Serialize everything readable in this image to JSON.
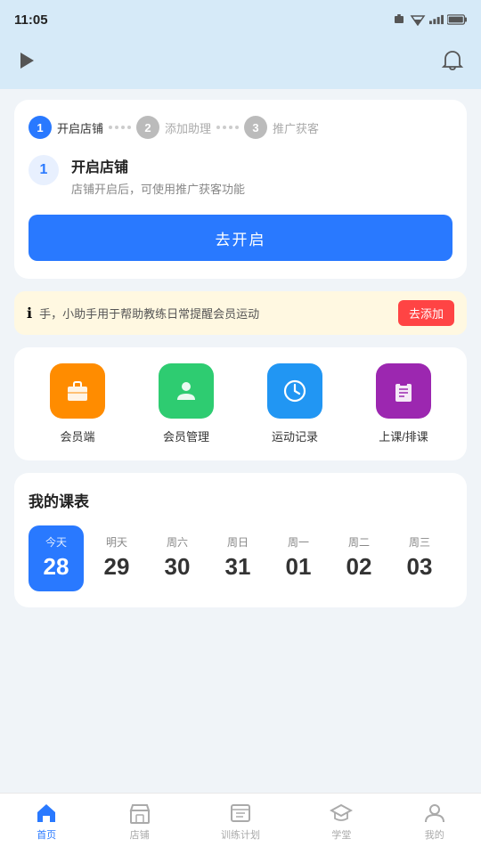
{
  "statusBar": {
    "time": "11:05",
    "icons": "▲ ▲ 🔋"
  },
  "header": {
    "playLabel": "play",
    "bellLabel": "notification"
  },
  "steps": {
    "step1": {
      "num": "1",
      "label": "开启店铺",
      "active": true
    },
    "step2": {
      "num": "2",
      "label": "添加助理",
      "active": false
    },
    "step3": {
      "num": "3",
      "label": "推广获客",
      "active": false
    },
    "detailNum": "1",
    "detailTitle": "开启店铺",
    "detailDesc": "店铺开启后，可使用推广获客功能",
    "btnLabel": "去开启"
  },
  "notice": {
    "icon": "ℹ",
    "text": "手，小助手用于帮助教练日常提醒会员运动",
    "btnLabel": "去添加"
  },
  "quickActions": [
    {
      "id": "member-app",
      "label": "会员端",
      "icon": "💼",
      "color": "orange"
    },
    {
      "id": "member-manage",
      "label": "会员管理",
      "icon": "👤",
      "color": "green"
    },
    {
      "id": "sports-record",
      "label": "运动记录",
      "icon": "⏰",
      "color": "blue"
    },
    {
      "id": "class-schedule",
      "label": "上课/排课",
      "icon": "📋",
      "color": "purple"
    }
  ],
  "schedule": {
    "title": "我的课表",
    "days": [
      {
        "label": "今天",
        "num": "28",
        "today": true
      },
      {
        "label": "明天",
        "num": "29",
        "today": false
      },
      {
        "label": "周六",
        "num": "30",
        "today": false
      },
      {
        "label": "周日",
        "num": "31",
        "today": false
      },
      {
        "label": "周一",
        "num": "01",
        "today": false
      },
      {
        "label": "周二",
        "num": "02",
        "today": false
      },
      {
        "label": "周三",
        "num": "03",
        "today": false
      }
    ]
  },
  "bottomNav": [
    {
      "id": "home",
      "label": "首页",
      "active": true
    },
    {
      "id": "store",
      "label": "店铺",
      "active": false
    },
    {
      "id": "training",
      "label": "训练计划",
      "active": false
    },
    {
      "id": "academy",
      "label": "学堂",
      "active": false
    },
    {
      "id": "mine",
      "label": "我的",
      "active": false
    }
  ],
  "colors": {
    "primary": "#2979ff",
    "accent": "#ff4444",
    "bg": "#d6eaf8"
  }
}
